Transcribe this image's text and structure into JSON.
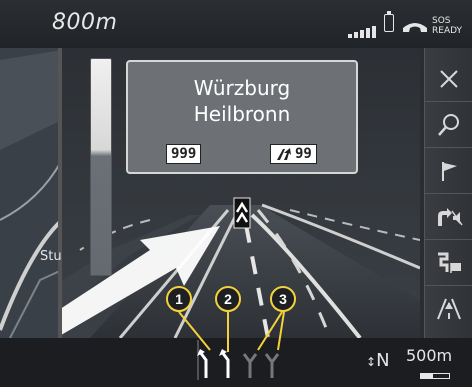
{
  "status_bar": {
    "distance": "800m",
    "sos_line1": "SOS",
    "sos_line2": "READY",
    "signal_icon": "signal-strength-icon",
    "battery_icon": "battery-icon",
    "phone_icon": "phone-icon"
  },
  "direction_sign": {
    "line1": "Würzburg",
    "line2": "Heilbronn",
    "left_road_number": "999",
    "right_road_number": "99"
  },
  "side_menu": [
    {
      "icon": "close-icon"
    },
    {
      "icon": "search-icon"
    },
    {
      "icon": "flag-icon"
    },
    {
      "icon": "turn-mute-icon"
    },
    {
      "icon": "route-destination-icon"
    },
    {
      "icon": "lane-view-icon"
    }
  ],
  "bottom_bar": {
    "compass": "N",
    "scale": "500m"
  },
  "map_label": "Stu",
  "callouts": [
    "1",
    "2",
    "3"
  ],
  "colors": {
    "callout_ring": "#f4d23b",
    "road_surface": "#3e4349",
    "guidance_arrow": "#ffffff"
  }
}
